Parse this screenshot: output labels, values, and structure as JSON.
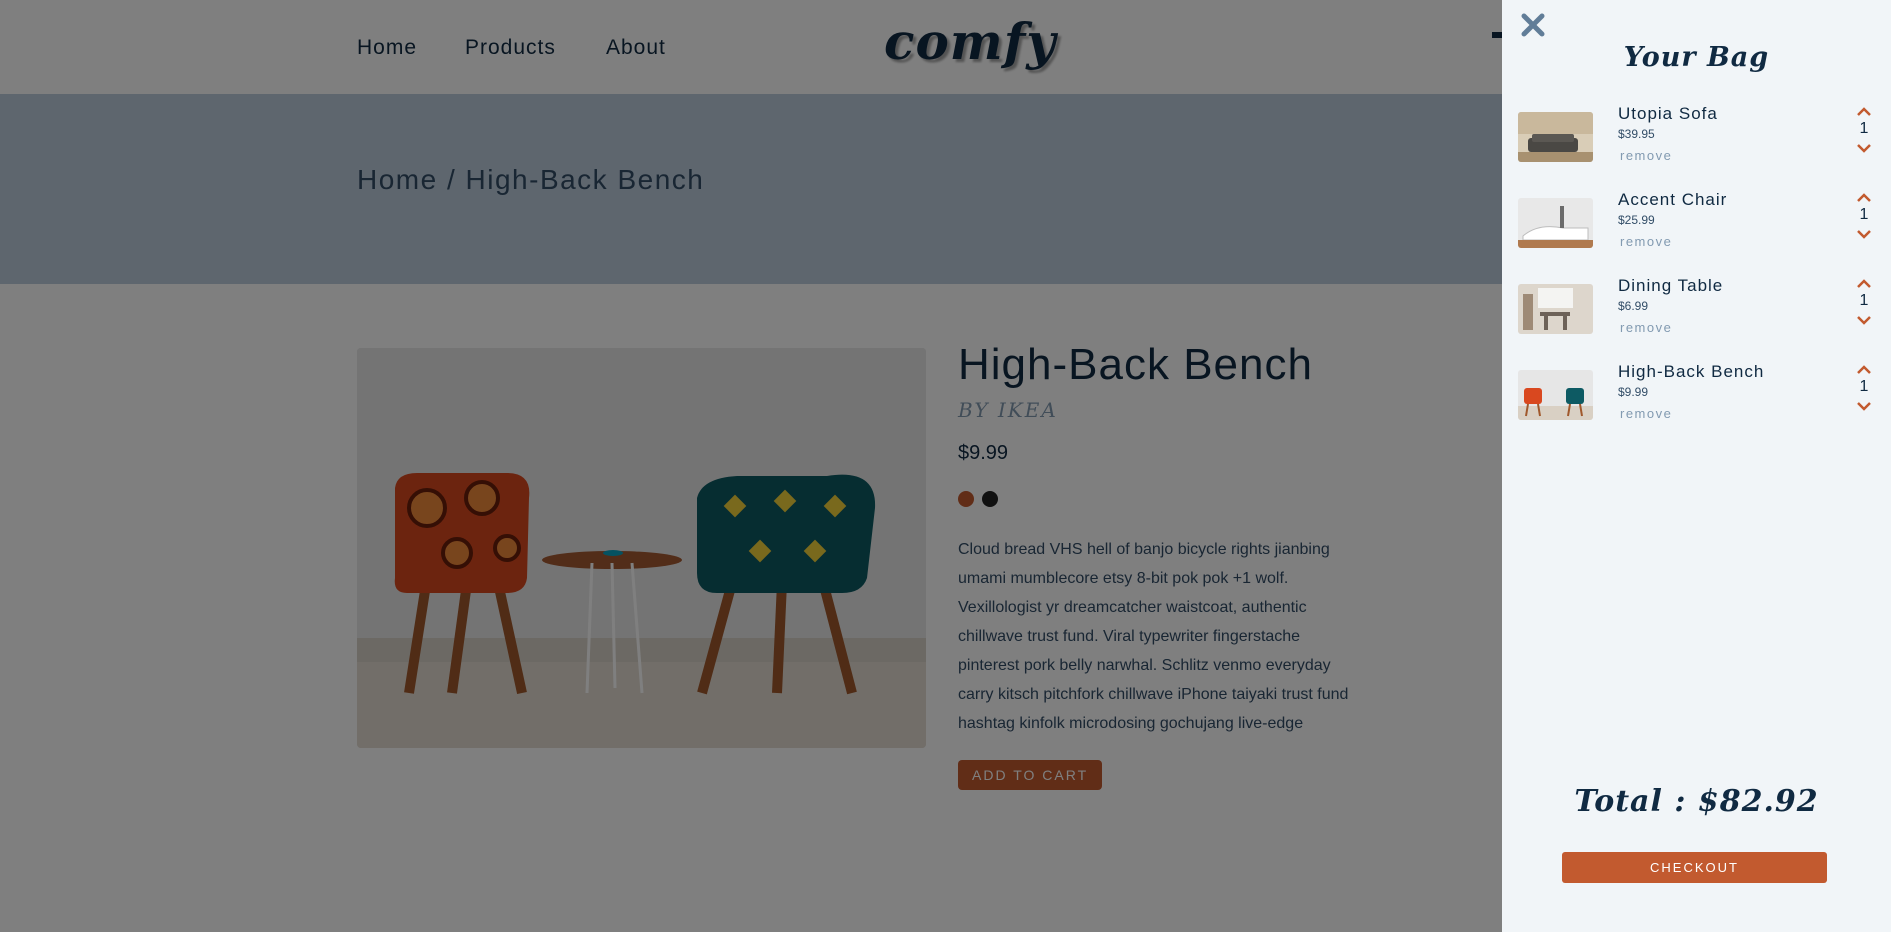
{
  "nav": {
    "links": [
      "Home",
      "Products",
      "About"
    ],
    "logo": "comfy"
  },
  "hero": {
    "breadcrumb": "Home / High-Back Bench"
  },
  "product": {
    "title": "High-Back Bench",
    "company": "by ikea",
    "price": "$9.99",
    "colors": [
      "#c25a2f",
      "#222222"
    ],
    "description": "Cloud bread VHS hell of banjo bicycle rights jianbing umami mumblecore etsy 8-bit pok pok +1 wolf. Vexillologist yr dreamcatcher waistcoat, authentic chillwave trust fund. Viral typewriter fingerstache pinterest pork belly narwhal. Schlitz venmo everyday carry kitsch pitchfork chillwave iPhone taiyaki trust fund hashtag kinfolk microdosing gochujang live-edge",
    "add_to_cart": "add to cart"
  },
  "cart": {
    "title": "Your Bag",
    "items": [
      {
        "name": "Utopia Sofa",
        "price": "$39.95",
        "remove": "remove",
        "qty": "1"
      },
      {
        "name": "Accent Chair",
        "price": "$25.99",
        "remove": "remove",
        "qty": "1"
      },
      {
        "name": "Dining Table",
        "price": "$6.99",
        "remove": "remove",
        "qty": "1"
      },
      {
        "name": "High-Back Bench",
        "price": "$9.99",
        "remove": "remove",
        "qty": "1"
      }
    ],
    "total": "Total : $82.92",
    "checkout": "checkout"
  },
  "theme": {
    "accent": "#c25a2f",
    "text_dark": "#102a42",
    "hero_bg": "#bcccdc",
    "sidebar_bg": "#f1f5f8"
  }
}
